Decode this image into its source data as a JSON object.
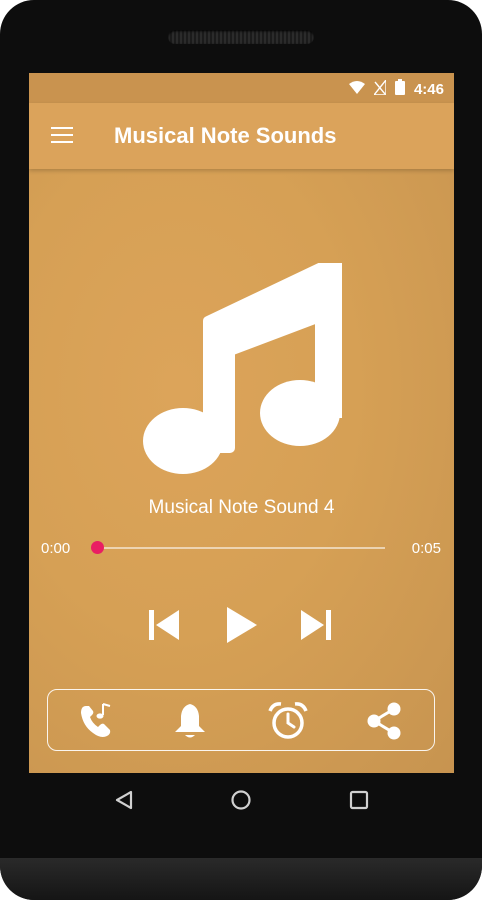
{
  "status_bar": {
    "time": "4:46",
    "icons": [
      "wifi-icon",
      "no-signal-icon",
      "battery-icon"
    ]
  },
  "app_bar": {
    "title": "Musical Note Sounds",
    "menu_icon": "hamburger-menu-icon"
  },
  "player": {
    "artwork_icon": "music-note-icon",
    "track_title": "Musical Note Sound 4",
    "elapsed": "0:00",
    "duration": "0:05",
    "progress": 0.0,
    "controls": [
      "skip-previous-icon",
      "play-icon",
      "skip-next-icon"
    ]
  },
  "actions": [
    {
      "name": "set-ringtone",
      "icon": "phone-ringtone-icon"
    },
    {
      "name": "set-notification",
      "icon": "bell-icon"
    },
    {
      "name": "set-alarm",
      "icon": "alarm-clock-icon"
    },
    {
      "name": "share",
      "icon": "share-icon"
    }
  ],
  "colors": {
    "accent": "#e91e63",
    "app_bar": "#dba35b",
    "background": "#d6a055"
  },
  "nav_bar": [
    "back-icon",
    "home-icon",
    "recents-icon"
  ]
}
